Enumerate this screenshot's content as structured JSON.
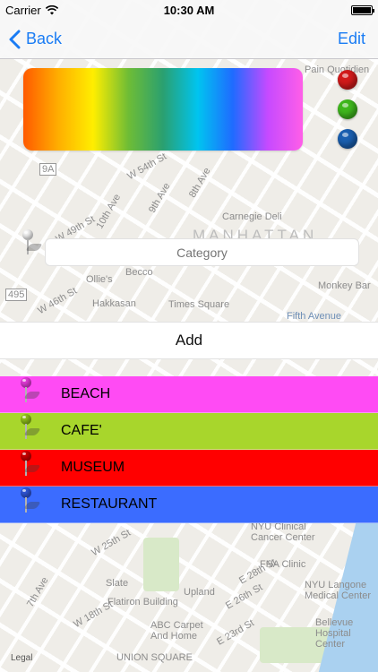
{
  "status_bar": {
    "carrier": "Carrier",
    "time": "10:30 AM",
    "battery_level": 1.0
  },
  "nav": {
    "back_label": "Back",
    "edit_label": "Edit"
  },
  "palette": {
    "gradient_stops": [
      "#ff5a00",
      "#ffae00",
      "#ffee00",
      "#6fbd35",
      "#2aa070",
      "#00c4f0",
      "#1f6bff",
      "#c64aff",
      "#ff5ee8"
    ],
    "swatches": [
      {
        "name": "red",
        "color": "#d21a1a"
      },
      {
        "name": "green",
        "color": "#3fb71d"
      },
      {
        "name": "blue",
        "color": "#1a5fb0"
      }
    ]
  },
  "category": {
    "placeholder": "Category",
    "pin_color": "#f4f4f4"
  },
  "add": {
    "label": "Add"
  },
  "categories": [
    {
      "label": "BEACH",
      "color": "#ff4bf4",
      "pin_color": "#e23bd8"
    },
    {
      "label": "CAFE'",
      "color": "#a8d62c",
      "pin_color": "#8fbf1a"
    },
    {
      "label": "MUSEUM",
      "color": "#ff0000",
      "pin_color": "#cc0000"
    },
    {
      "label": "RESTAURANT",
      "color": "#3b6cff",
      "pin_color": "#2f55d6"
    }
  ],
  "map": {
    "labels": [
      "MANHATTAN",
      "Carnegie Deli",
      "Times Square",
      "Becco",
      "Ollie's",
      "Hakkasan",
      "Monkey Bar",
      "Fifth Avenue",
      "W 54th St",
      "W 49th St",
      "W 46th St",
      "10th Ave",
      "9th Ave",
      "8th Ave",
      "NYU Clinical Cancer Center",
      "FNA Clinic",
      "NYU Langone Medical Center",
      "Bellevue Hospital Center",
      "Slate",
      "Flatiron Building",
      "Upland",
      "ABC Carpet And Home",
      "UNION SQUARE",
      "7th Ave",
      "W 25th St",
      "W 18th St",
      "E 28th St",
      "E 26th St",
      "E 23rd St",
      "Pain Quotidien",
      "495",
      "9A"
    ],
    "legal": "Legal"
  }
}
